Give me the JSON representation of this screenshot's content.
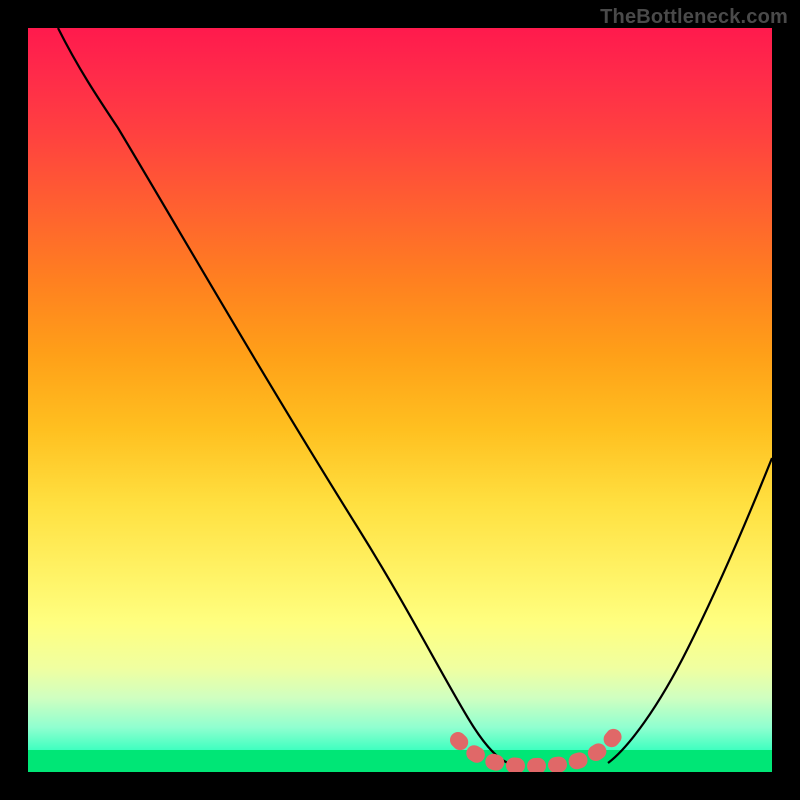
{
  "watermark": "TheBottleneck.com",
  "chart_data": {
    "type": "line",
    "title": "",
    "xlabel": "",
    "ylabel": "",
    "xlim": [
      0,
      100
    ],
    "ylim": [
      0,
      100
    ],
    "series": [
      {
        "name": "left-curve",
        "x": [
          4,
          8,
          12,
          18,
          24,
          30,
          36,
          42,
          48,
          54,
          57,
          60,
          63,
          66
        ],
        "y": [
          100,
          94,
          88,
          80,
          70,
          60,
          50,
          40,
          30,
          18,
          12,
          7,
          4,
          2
        ]
      },
      {
        "name": "right-curve",
        "x": [
          78,
          82,
          86,
          90,
          94,
          98,
          100
        ],
        "y": [
          2,
          6,
          12,
          20,
          30,
          42,
          48
        ]
      },
      {
        "name": "highlight-dots",
        "x": [
          58,
          62,
          66,
          70,
          74,
          78
        ],
        "y": [
          4,
          2,
          1.5,
          1.5,
          2,
          4
        ]
      }
    ],
    "annotations": [],
    "grid": false,
    "gradient_colors_top_to_bottom": [
      "#ff1a4d",
      "#ff8020",
      "#ffe040",
      "#ffff80",
      "#00f080"
    ]
  }
}
